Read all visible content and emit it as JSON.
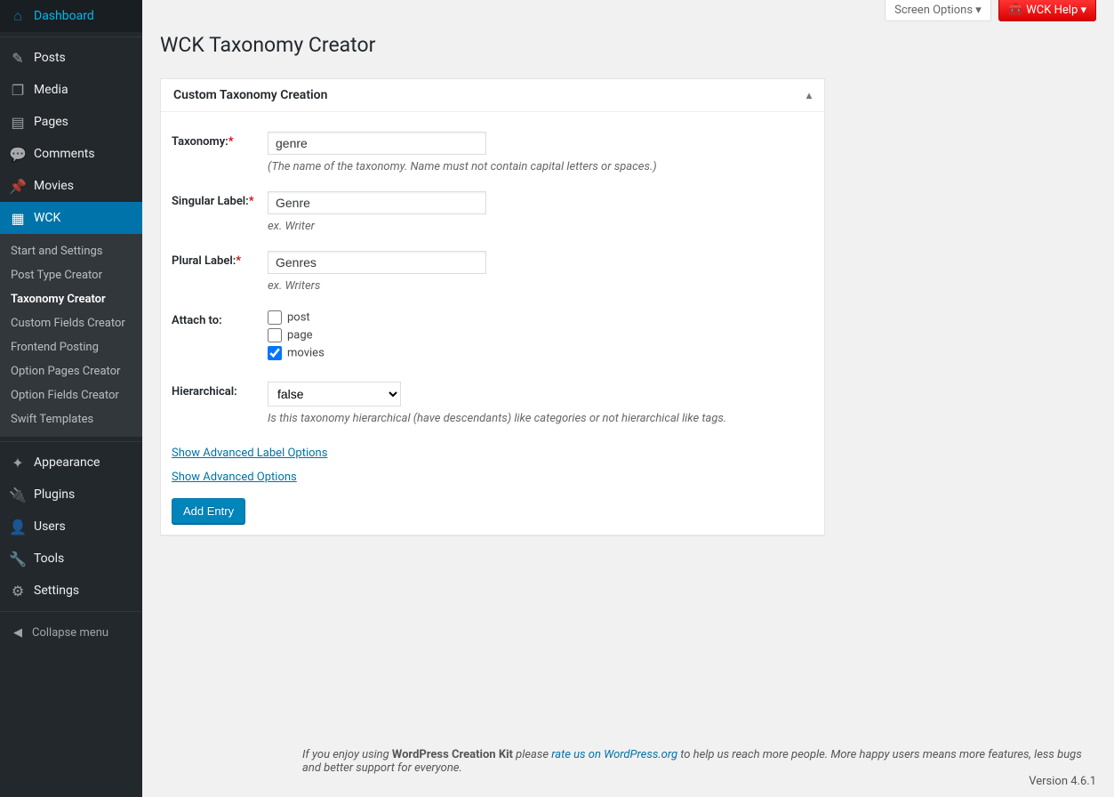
{
  "sidebar": {
    "items": [
      {
        "icon": "⌂",
        "label": "Dashboard"
      },
      {
        "icon": "✎",
        "label": "Posts"
      },
      {
        "icon": "❐",
        "label": "Media"
      },
      {
        "icon": "▤",
        "label": "Pages"
      },
      {
        "icon": "💬",
        "label": "Comments"
      },
      {
        "icon": "📌",
        "label": "Movies"
      },
      {
        "icon": "▦",
        "label": "WCK"
      }
    ],
    "submenu": [
      "Start and Settings",
      "Post Type Creator",
      "Taxonomy Creator",
      "Custom Fields Creator",
      "Frontend Posting",
      "Option Pages Creator",
      "Option Fields Creator",
      "Swift Templates"
    ],
    "items2": [
      {
        "icon": "✦",
        "label": "Appearance"
      },
      {
        "icon": "🔌",
        "label": "Plugins"
      },
      {
        "icon": "👤",
        "label": "Users"
      },
      {
        "icon": "🔧",
        "label": "Tools"
      },
      {
        "icon": "⚙",
        "label": "Settings"
      }
    ],
    "collapse": "Collapse menu"
  },
  "topbar": {
    "screen_options": "Screen Options ▾",
    "help_label": "WCK Help ▾"
  },
  "page_title": "WCK Taxonomy Creator",
  "panel": {
    "title": "Custom Taxonomy Creation",
    "toggle": "▴"
  },
  "form": {
    "taxonomy_label": "Taxonomy:",
    "taxonomy_value": "genre",
    "taxonomy_desc": "(The name of the taxonomy. Name must not contain capital letters or spaces.)",
    "singular_label": "Singular Label:",
    "singular_value": "Genre",
    "singular_desc": "ex. Writer",
    "plural_label": "Plural Label:",
    "plural_value": "Genres",
    "plural_desc": "ex. Writers",
    "attach_label": "Attach to:",
    "attach_options": [
      {
        "label": "post",
        "checked": false
      },
      {
        "label": "page",
        "checked": false
      },
      {
        "label": "movies",
        "checked": true
      }
    ],
    "hierarchical_label": "Hierarchical:",
    "hierarchical_value": "false",
    "hierarchical_desc": "Is this taxonomy hierarchical (have descendants) like categories or not hierarchical like tags.",
    "adv_label_link": "Show Advanced Label Options",
    "adv_link": "Show Advanced Options",
    "add_entry": "Add Entry"
  },
  "footer": {
    "prefix": "If you enjoy using ",
    "product": "WordPress Creation Kit",
    "mid": " please ",
    "rate_link": "rate us on WordPress.org",
    "suffix": " to help us reach more people. More happy users means more features, less bugs and better support for everyone.",
    "version": "Version 4.6.1"
  }
}
